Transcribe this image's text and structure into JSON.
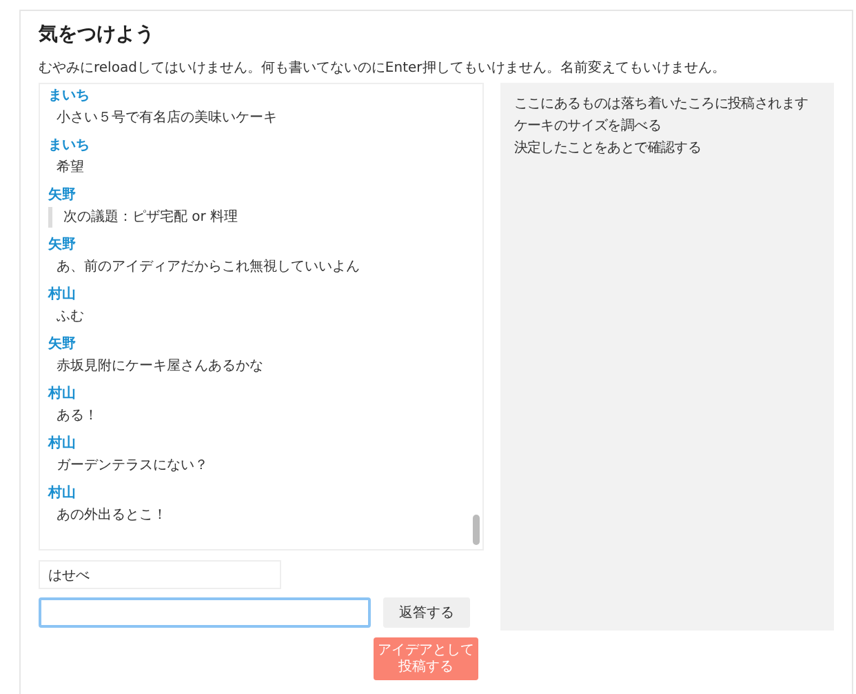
{
  "title": "気をつけよう",
  "notice": "むやみにreloadしてはいけません。何も書いてないのにEnter押してもいけません。名前変えてもいけません。",
  "messages": [
    {
      "author": "まいち",
      "text": "小さい５号で有名店の美味いケーキ",
      "kind": "text"
    },
    {
      "author": "まいち",
      "text": "希望",
      "kind": "text"
    },
    {
      "author": "矢野",
      "text": "次の議題：ピザ宅配 or 料理",
      "kind": "quote"
    },
    {
      "author": "矢野",
      "text": "あ、前のアイディアだからこれ無視していいよん",
      "kind": "text"
    },
    {
      "author": "村山",
      "text": "ふむ",
      "kind": "text"
    },
    {
      "author": "矢野",
      "text": "赤坂見附にケーキ屋さんあるかな",
      "kind": "text"
    },
    {
      "author": "村山",
      "text": "ある！",
      "kind": "text"
    },
    {
      "author": "村山",
      "text": "ガーデンテラスにない？",
      "kind": "text"
    },
    {
      "author": "村山",
      "text": "あの外出るとこ！",
      "kind": "text"
    }
  ],
  "name_field": {
    "value": "はせべ"
  },
  "message_field": {
    "focused": true
  },
  "reply_button": "返答する",
  "idea_button": "アイデアとして投稿する",
  "ideas": [
    "ここにあるものは落ち着いたころに投稿されます",
    "ケーキのサイズを調べる",
    "決定したことをあとで確認する"
  ]
}
